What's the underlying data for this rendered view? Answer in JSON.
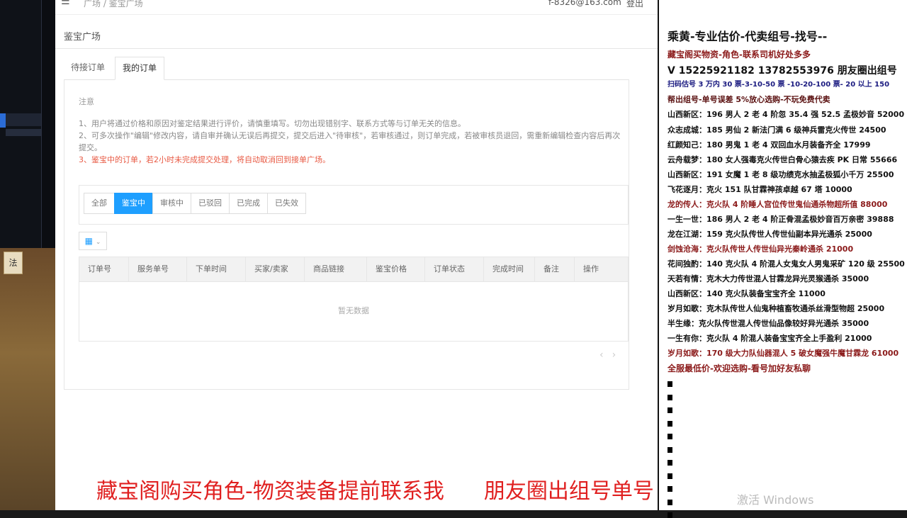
{
  "topbar": {
    "menu_icon": "menu-icon",
    "breadcrumb": "广场 / 鉴宝广场",
    "user_email": "f-8326@163.com",
    "logout": "登出"
  },
  "page": {
    "title": "鉴宝广场"
  },
  "tabs": [
    {
      "label": "待接订单",
      "active": false
    },
    {
      "label": "我的订单",
      "active": true
    }
  ],
  "notice": {
    "title": "注意",
    "line1": "1、用户将通过价格和原因对鉴定结果进行评价，请慎重填写。切勿出现错别字、联系方式等与订单无关的信息。",
    "line2": "2、可多次操作\"编辑\"修改内容，请自审并确认无误后再提交，提交后进入\"待审核\"，若审核通过，则订单完成，若被审核员退回，需重新编辑检查内容后再次提交。",
    "line3": "3、鉴宝中的订单，若2小时未完成提交处理，将自动取消回到接单广场。"
  },
  "filters": [
    {
      "label": "全部",
      "active": false
    },
    {
      "label": "鉴宝中",
      "active": true
    },
    {
      "label": "审核中",
      "active": false
    },
    {
      "label": "已驳回",
      "active": false
    },
    {
      "label": "已完成",
      "active": false
    },
    {
      "label": "已失效",
      "active": false
    }
  ],
  "grid_toggle": {
    "icon": "grid-icon",
    "caret": "chevron-down-icon"
  },
  "table": {
    "columns": [
      "订单号",
      "服务单号",
      "下单时间",
      "买家/卖家",
      "商品链接",
      "鉴宝价格",
      "订单状态",
      "完成时间",
      "备注",
      "操作"
    ],
    "empty_text": "暂无数据"
  },
  "pager": {
    "prev": "‹",
    "next": "›"
  },
  "overlay": {
    "left": "藏宝阁购买角色-物资装备提前联系我",
    "right": "朋友圈出组号单号"
  },
  "windows_watermark": "激活 Windows",
  "right_panel": {
    "brand": "",
    "lines": [
      {
        "text": "乘黄-专业估价-代卖组号-找号--",
        "color": "#111111",
        "size": 16
      },
      {
        "text": "藏宝阁买物资-角色-联系司机好处多多",
        "color": "#8b1a1a",
        "size": 12
      },
      {
        "text": "V 15225921182   13782553976 朋友圈出组号",
        "color": "#111111",
        "size": 14
      },
      {
        "text": "扫码估号 3 万内 30 票-3-10-50 票  -10-20-100 票- 20 以上 150",
        "color": "#1a1a80",
        "size": 10
      },
      {
        "text": "帮出组号-单号误差 5%放心选购-不玩免费代卖",
        "color": "#5a1010",
        "size": 11
      },
      {
        "text": "山西新区：196 男人 2 老 4 阶忽 35.4 强 52.5 孟极妙音 52000",
        "color": "#111111",
        "size": 11
      },
      {
        "text": "众志成城：185 男仙 2 新法门满 6 级神兵雷克火传世 24500",
        "color": "#111111",
        "size": 11
      },
      {
        "text": "红颜知己：180 男鬼 1 老 4 双回血水月装备齐全 17999",
        "color": "#111111",
        "size": 11
      },
      {
        "text": "云舟载梦：180 女人强毒克火传世白骨心猿去疾 PK 日常 55666",
        "color": "#111111",
        "size": 11
      },
      {
        "text": "山西新区：191 女魔 1 老 8 级功绩克水抽孟极狐小千万 25500",
        "color": "#111111",
        "size": 11
      },
      {
        "text": "飞花逐月：克火 151 队甘霖神孩卓越 67 塔 10000",
        "color": "#111111",
        "size": 11
      },
      {
        "text": "龙的传人：克火队 4 阶睡人宫位传世鬼仙通杀物超所值 88000",
        "color": "#8b1a1a",
        "size": 11
      },
      {
        "text": "一生一世：186 男人 2 老 4 阶正骨混孟极妙音百万亲密 39888",
        "color": "#111111",
        "size": 11
      },
      {
        "text": "龙在江湖：159 克火队传世人传世仙副本异光通杀 25000",
        "color": "#111111",
        "size": 11
      },
      {
        "text": "剑蚀沧海：克火队传世人传世仙异光秦岭通杀 21000",
        "color": "#8b1a1a",
        "size": 11
      },
      {
        "text": "花间独酌：140 克火队 4 阶混人女鬼女人男鬼采矿 120 级 25500",
        "color": "#111111",
        "size": 11
      },
      {
        "text": "天若有情：克木大力传世混人甘霖龙异光灵猴通杀 35000",
        "color": "#111111",
        "size": 11
      },
      {
        "text": "山西新区：140 克火队装备宝宝齐全 11000",
        "color": "#111111",
        "size": 11
      },
      {
        "text": "岁月如歌：克木队传世人仙鬼种植畜牧通杀丝滑型物超 25000",
        "color": "#111111",
        "size": 11
      },
      {
        "text": "半生缘：克火队传世混人传世仙品像较好异光通杀 35000",
        "color": "#111111",
        "size": 11
      },
      {
        "text": "一生有你：克火队 4 阶混人装备宝宝齐全上手盈利 21000",
        "color": "#111111",
        "size": 11
      },
      {
        "text": "岁月如歌：170 级大力队仙器混人 5 破女魔强牛魔甘霖龙 61000",
        "color": "#8b1a1a",
        "size": 11
      },
      {
        "text": "全服最低价-欢迎选购-看号加好友私聊",
        "color": "#8b1a1a",
        "size": 12
      }
    ]
  }
}
